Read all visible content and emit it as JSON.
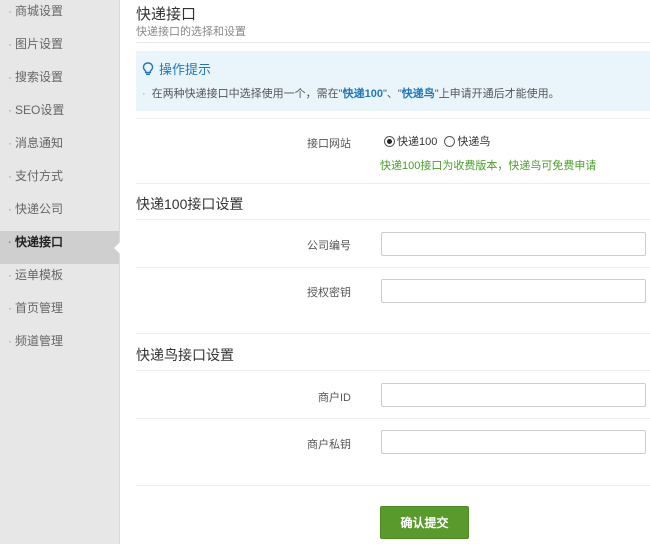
{
  "sidebar": {
    "items": [
      {
        "label": "商城设置"
      },
      {
        "label": "图片设置"
      },
      {
        "label": "搜索设置"
      },
      {
        "label": "SEO设置"
      },
      {
        "label": "消息通知"
      },
      {
        "label": "支付方式"
      },
      {
        "label": "快递公司"
      },
      {
        "label": "快递接口"
      },
      {
        "label": "运单模板"
      },
      {
        "label": "首页管理"
      },
      {
        "label": "频道管理"
      }
    ],
    "active": "快递接口",
    "bullet": "·"
  },
  "header": {
    "title": "快递接口",
    "subtitle": "快递接口的选择和设置"
  },
  "tips": {
    "title": "操作提示",
    "bullet": "·",
    "text_before": "在两种快递接口中选择使用一个，需在\"",
    "highlight1": "快递100",
    "text_mid": "\"、\"",
    "highlight2": "快递鸟",
    "text_after": "\"上申请开通后才能使用。"
  },
  "interface": {
    "label": "接口网站",
    "options": [
      "快递100",
      "快递鸟"
    ],
    "selected": "快递100",
    "hint": "快递100接口为收费版本，快递鸟可免费申请"
  },
  "kd100": {
    "section_title": "快递100接口设置",
    "company_code_label": "公司编号",
    "company_code_value": "",
    "auth_key_label": "授权密钥",
    "auth_key_value": ""
  },
  "kdniao": {
    "section_title": "快递鸟接口设置",
    "merchant_id_label": "商户ID",
    "merchant_id_value": "",
    "merchant_key_label": "商户私钥",
    "merchant_key_value": ""
  },
  "actions": {
    "submit_label": "确认提交"
  },
  "colors": {
    "accent_blue": "#2277bb",
    "hint_green": "#4a9e2a",
    "button_green": "#5a9a2c",
    "sidebar_bg": "#e7e7e7"
  }
}
